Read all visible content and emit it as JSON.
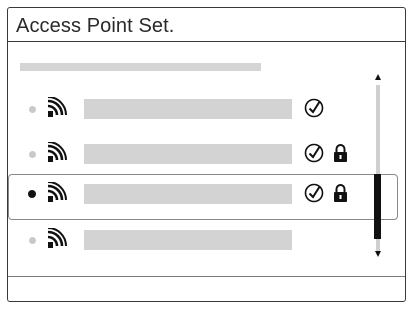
{
  "screen": {
    "title": "Access Point Set."
  },
  "access_points": [
    {
      "selected": false,
      "has_check": true,
      "has_lock": false
    },
    {
      "selected": false,
      "has_check": true,
      "has_lock": true
    },
    {
      "selected": true,
      "has_check": true,
      "has_lock": true
    },
    {
      "selected": false,
      "has_check": false,
      "has_lock": false
    }
  ],
  "icons": {
    "signal": "wifi-signal-icon",
    "check": "check-circle-icon",
    "lock": "lock-icon"
  },
  "colors": {
    "border": "#3a3a3a",
    "placeholder": "#d3d3d3",
    "active": "#111111"
  }
}
